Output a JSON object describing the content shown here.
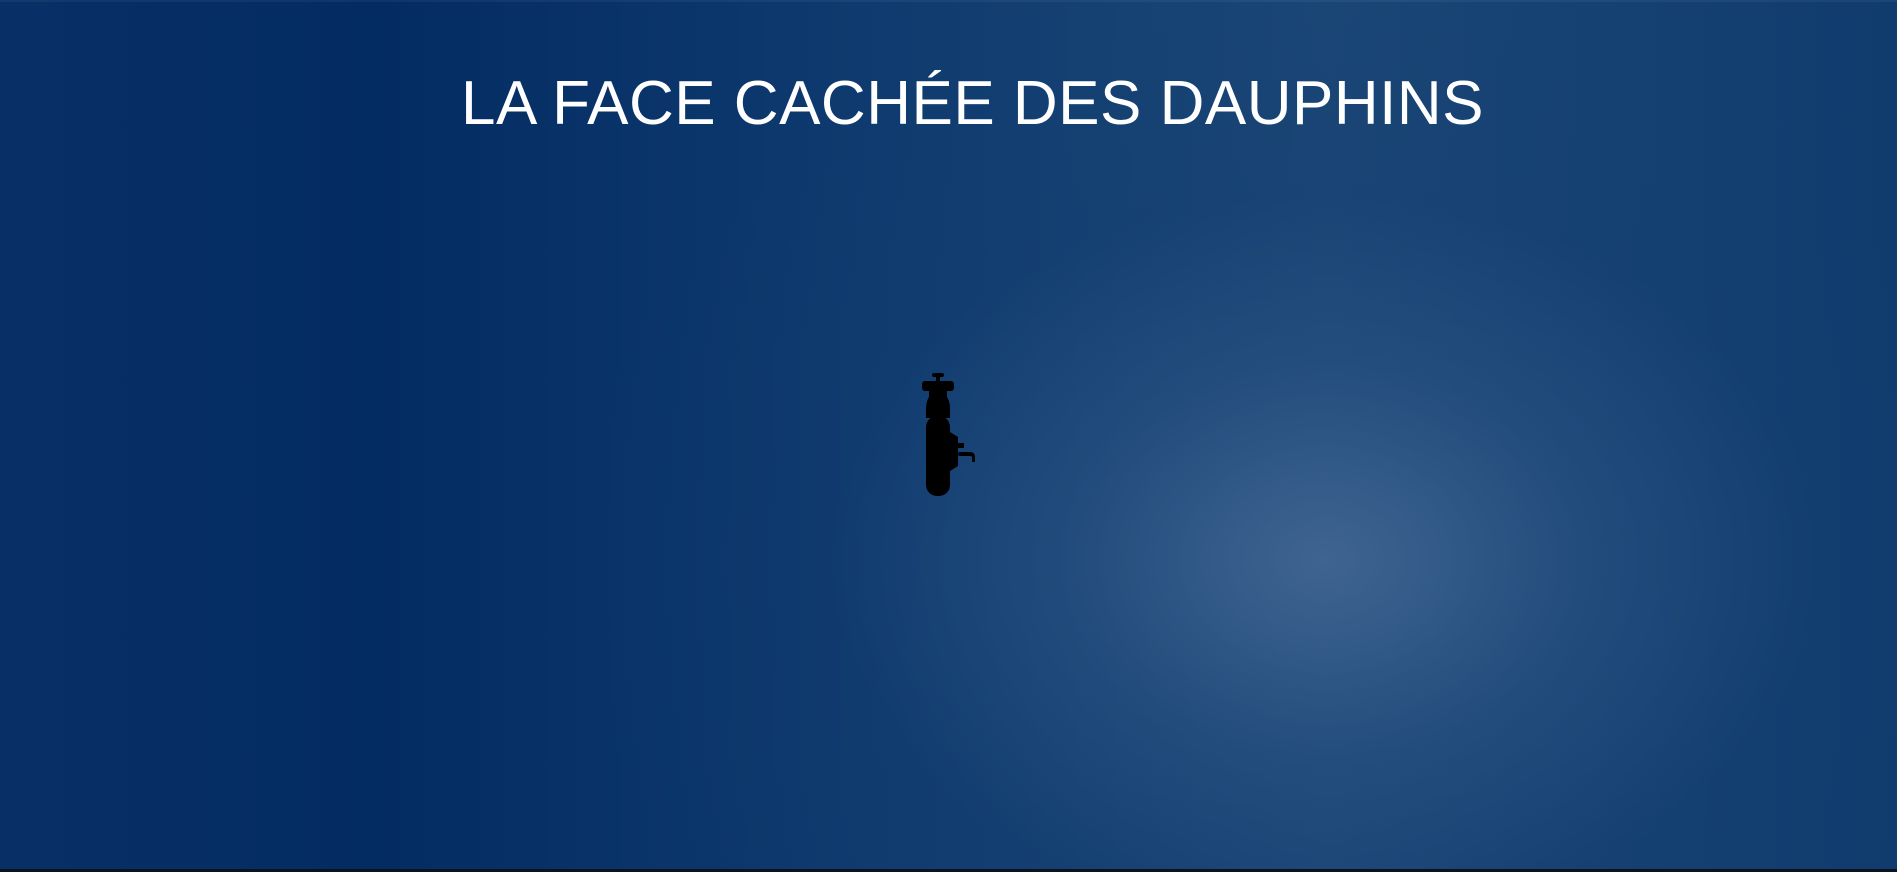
{
  "page": {
    "title": "LA FACE CACHÉE DES DAUPHINS"
  },
  "scene": {
    "object_icon": "scuba-tank-icon",
    "colors": {
      "deep": "#032c62",
      "mid": "#1a4676",
      "glow": "#3a6090",
      "title": "#ffffff",
      "object": "#000000"
    }
  }
}
